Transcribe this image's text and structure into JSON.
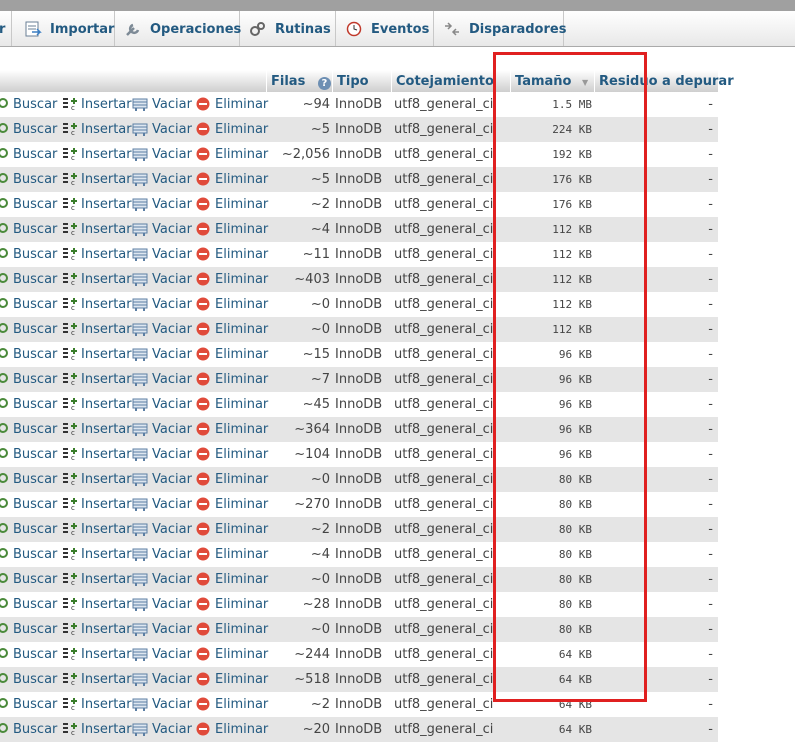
{
  "tabs": [
    {
      "label": "Importar",
      "icon": "import-icon"
    },
    {
      "label": "Operaciones",
      "icon": "wrench-icon"
    },
    {
      "label": "Rutinas",
      "icon": "routines-icon"
    },
    {
      "label": "Eventos",
      "icon": "clock-icon"
    },
    {
      "label": "Disparadores",
      "icon": "triggers-icon"
    }
  ],
  "columns": {
    "rows": "Filas",
    "type": "Tipo",
    "collation": "Cotejamiento",
    "size": "Tamaño",
    "overhead": "Residuo a depurar"
  },
  "actions": {
    "browse": "Buscar",
    "insert": "Insertar",
    "empty": "Vaciar",
    "drop": "Eliminar"
  },
  "table_rows": [
    {
      "rows": "~94",
      "engine": "InnoDB",
      "collation": "utf8_general_ci",
      "size": "1.5 MB",
      "overhead": "-"
    },
    {
      "rows": "~5",
      "engine": "InnoDB",
      "collation": "utf8_general_ci",
      "size": "224 KB",
      "overhead": "-"
    },
    {
      "rows": "~2,056",
      "engine": "InnoDB",
      "collation": "utf8_general_ci",
      "size": "192 KB",
      "overhead": "-"
    },
    {
      "rows": "~5",
      "engine": "InnoDB",
      "collation": "utf8_general_ci",
      "size": "176 KB",
      "overhead": "-"
    },
    {
      "rows": "~2",
      "engine": "InnoDB",
      "collation": "utf8_general_ci",
      "size": "176 KB",
      "overhead": "-"
    },
    {
      "rows": "~4",
      "engine": "InnoDB",
      "collation": "utf8_general_ci",
      "size": "112 KB",
      "overhead": "-"
    },
    {
      "rows": "~11",
      "engine": "InnoDB",
      "collation": "utf8_general_ci",
      "size": "112 KB",
      "overhead": "-"
    },
    {
      "rows": "~403",
      "engine": "InnoDB",
      "collation": "utf8_general_ci",
      "size": "112 KB",
      "overhead": "-"
    },
    {
      "rows": "~0",
      "engine": "InnoDB",
      "collation": "utf8_general_ci",
      "size": "112 KB",
      "overhead": "-"
    },
    {
      "rows": "~0",
      "engine": "InnoDB",
      "collation": "utf8_general_ci",
      "size": "112 KB",
      "overhead": "-"
    },
    {
      "rows": "~15",
      "engine": "InnoDB",
      "collation": "utf8_general_ci",
      "size": "96 KB",
      "overhead": "-"
    },
    {
      "rows": "~7",
      "engine": "InnoDB",
      "collation": "utf8_general_ci",
      "size": "96 KB",
      "overhead": "-"
    },
    {
      "rows": "~45",
      "engine": "InnoDB",
      "collation": "utf8_general_ci",
      "size": "96 KB",
      "overhead": "-"
    },
    {
      "rows": "~364",
      "engine": "InnoDB",
      "collation": "utf8_general_ci",
      "size": "96 KB",
      "overhead": "-"
    },
    {
      "rows": "~104",
      "engine": "InnoDB",
      "collation": "utf8_general_ci",
      "size": "96 KB",
      "overhead": "-"
    },
    {
      "rows": "~0",
      "engine": "InnoDB",
      "collation": "utf8_general_ci",
      "size": "80 KB",
      "overhead": "-"
    },
    {
      "rows": "~270",
      "engine": "InnoDB",
      "collation": "utf8_general_ci",
      "size": "80 KB",
      "overhead": "-"
    },
    {
      "rows": "~2",
      "engine": "InnoDB",
      "collation": "utf8_general_ci",
      "size": "80 KB",
      "overhead": "-"
    },
    {
      "rows": "~4",
      "engine": "InnoDB",
      "collation": "utf8_general_ci",
      "size": "80 KB",
      "overhead": "-"
    },
    {
      "rows": "~0",
      "engine": "InnoDB",
      "collation": "utf8_general_ci",
      "size": "80 KB",
      "overhead": "-"
    },
    {
      "rows": "~28",
      "engine": "InnoDB",
      "collation": "utf8_general_ci",
      "size": "80 KB",
      "overhead": "-"
    },
    {
      "rows": "~0",
      "engine": "InnoDB",
      "collation": "utf8_general_ci",
      "size": "80 KB",
      "overhead": "-"
    },
    {
      "rows": "~244",
      "engine": "InnoDB",
      "collation": "utf8_general_ci",
      "size": "64 KB",
      "overhead": "-"
    },
    {
      "rows": "~518",
      "engine": "InnoDB",
      "collation": "utf8_general_ci",
      "size": "64 KB",
      "overhead": "-"
    },
    {
      "rows": "~2",
      "engine": "InnoDB",
      "collation": "utf8_general_ci",
      "size": "64 KB",
      "overhead": "-"
    },
    {
      "rows": "~20",
      "engine": "InnoDB",
      "collation": "utf8_general_ci",
      "size": "64 KB",
      "overhead": "-"
    }
  ],
  "colors": {
    "link": "#235a81",
    "highlight": "#e02020",
    "row_alt": "#e5e5e5"
  }
}
